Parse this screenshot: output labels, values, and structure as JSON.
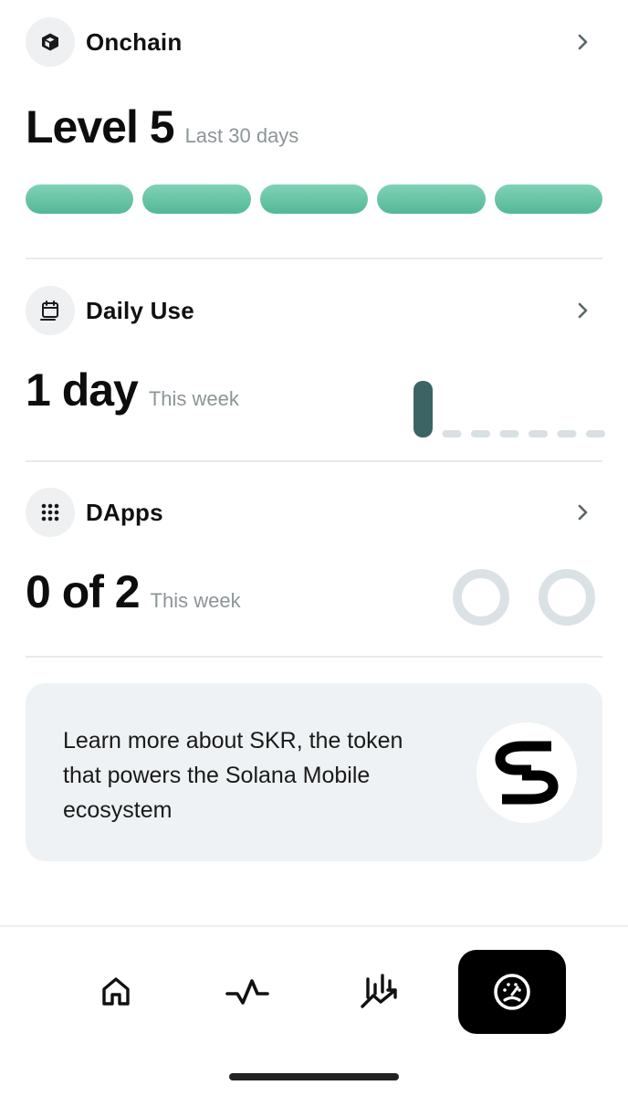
{
  "onchain": {
    "title": "Onchain",
    "icon": "cube-icon",
    "level_value": "Level 5",
    "level_period": "Last 30 days",
    "level_current": 5,
    "level_max": 5,
    "level_color": "#5cc09e"
  },
  "daily_use": {
    "title": "Daily Use",
    "icon": "calendar-icon",
    "value": "1 day",
    "period": "This week",
    "days_active": [
      true,
      false,
      false,
      false,
      false,
      false,
      false
    ],
    "active_color": "#3d6465",
    "inactive_color": "#d9e0e3"
  },
  "dapps": {
    "title": "DApps",
    "icon": "grid-dots-icon",
    "value": "0 of 2",
    "period": "This week",
    "used": 0,
    "total": 2,
    "ring_color": "#dbe2e6"
  },
  "promo": {
    "text": "Learn more about SKR, the token that powers the Solana Mobile ecosystem",
    "logo": "skr-logo"
  },
  "bottom_nav": {
    "items": [
      {
        "icon": "home-icon",
        "active": false
      },
      {
        "icon": "activity-pulse-icon",
        "active": false
      },
      {
        "icon": "trending-chart-icon",
        "active": false
      },
      {
        "icon": "gauge-icon",
        "active": true
      }
    ]
  }
}
